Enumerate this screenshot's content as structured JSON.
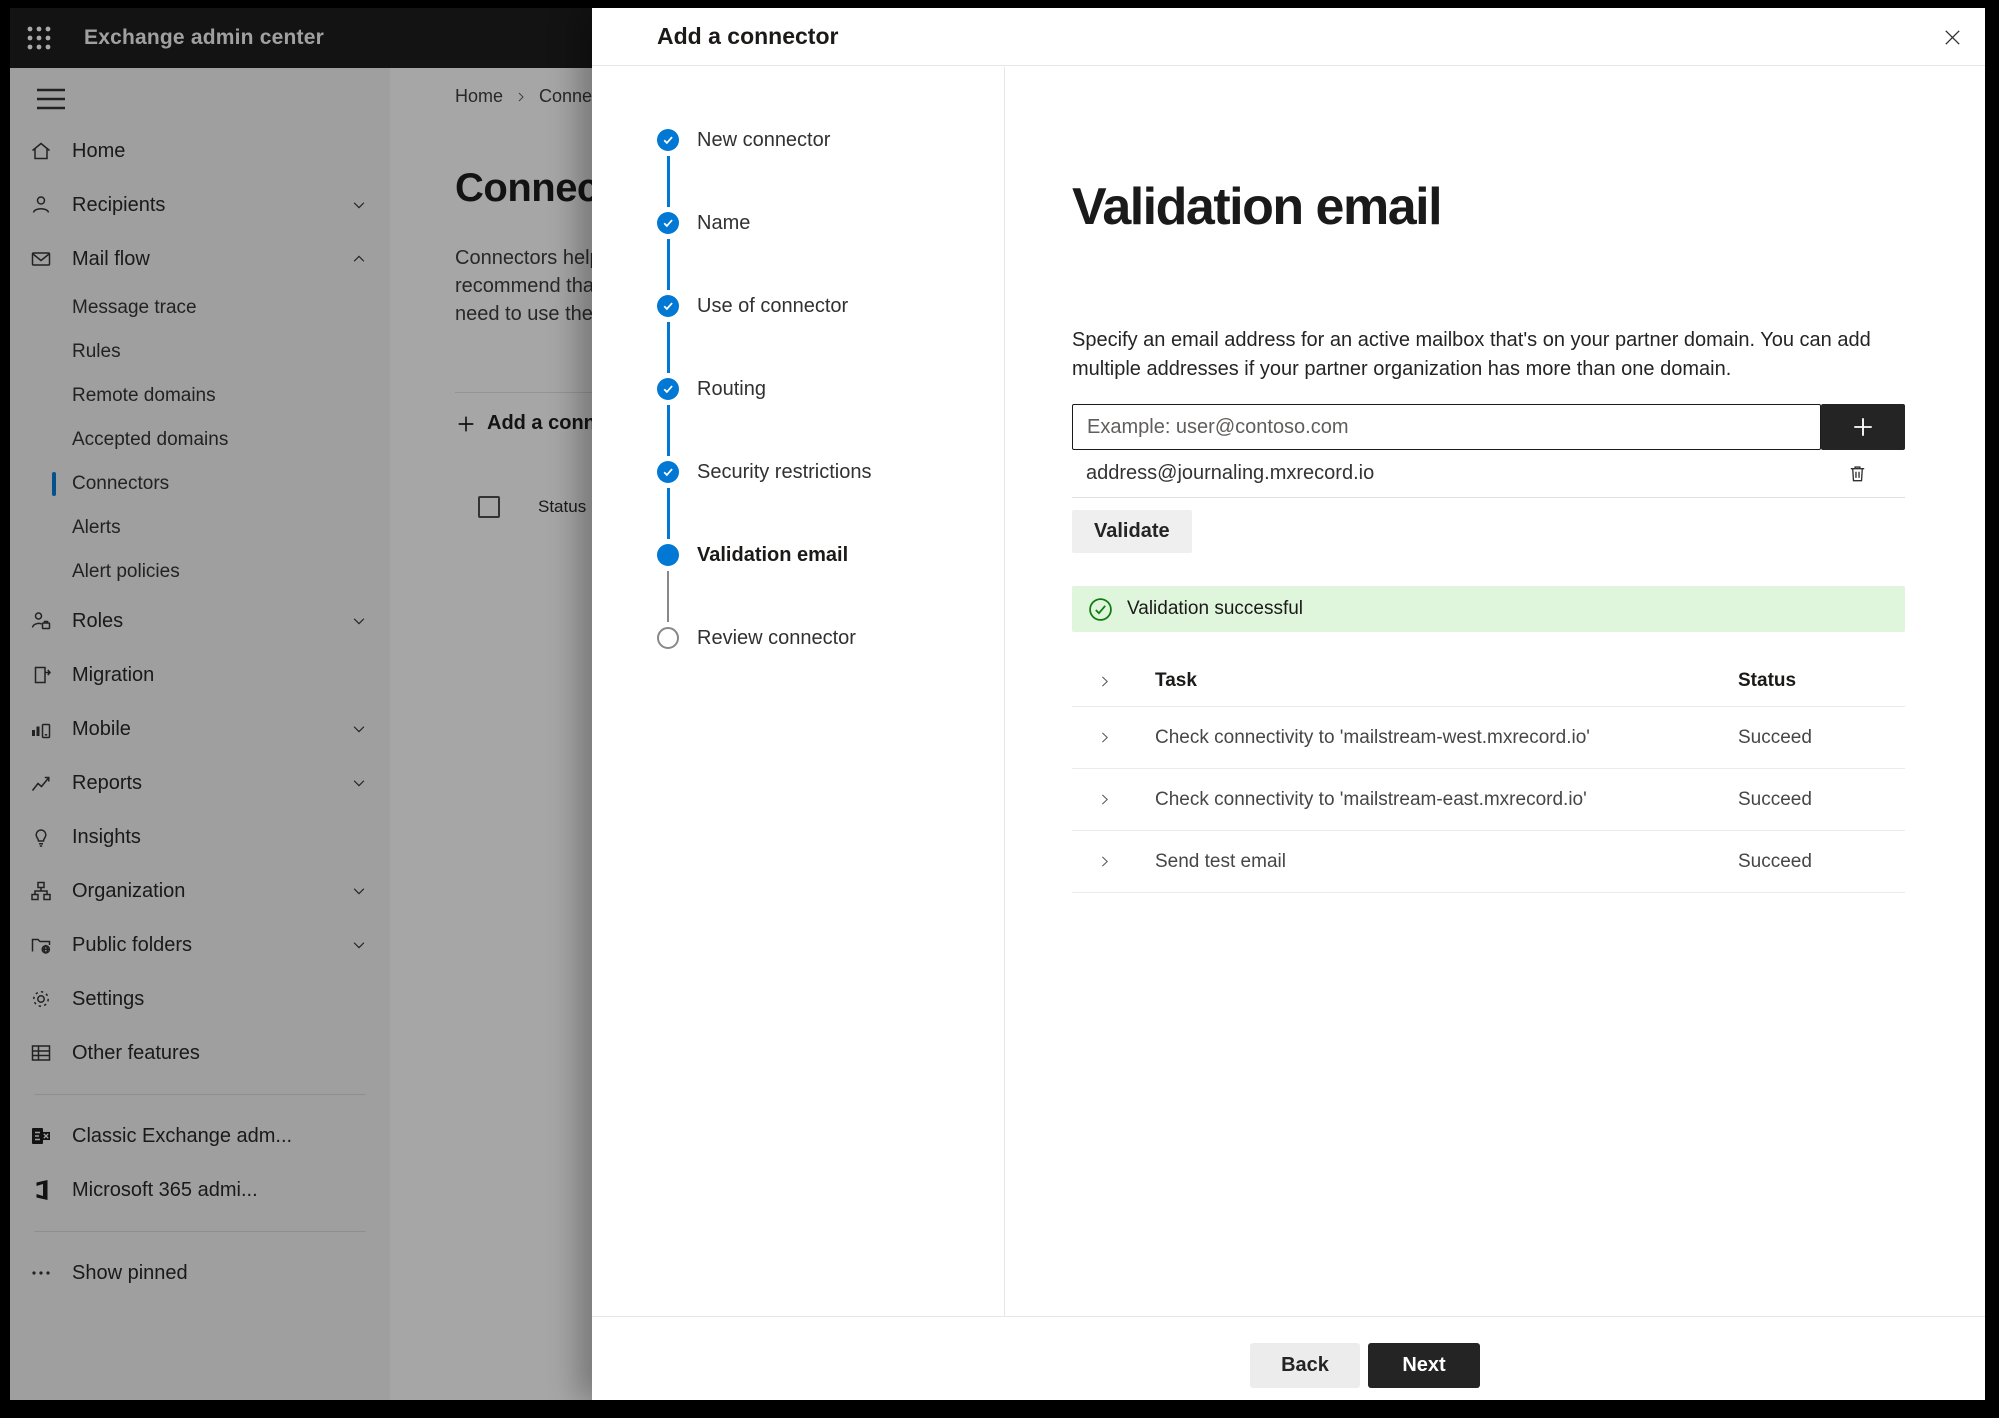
{
  "colors": {
    "accent": "#0078d4",
    "success_bg": "#dff6dd",
    "success_green": "#107c10",
    "dark_button": "#242424"
  },
  "topbar": {
    "title": "Exchange admin center"
  },
  "sidebar": {
    "items": [
      {
        "label": "Home"
      },
      {
        "label": "Recipients"
      },
      {
        "label": "Mail flow"
      },
      {
        "label": "Message trace"
      },
      {
        "label": "Rules"
      },
      {
        "label": "Remote domains"
      },
      {
        "label": "Accepted domains"
      },
      {
        "label": "Connectors",
        "selected": true
      },
      {
        "label": "Alerts"
      },
      {
        "label": "Alert policies"
      },
      {
        "label": "Roles"
      },
      {
        "label": "Migration"
      },
      {
        "label": "Mobile"
      },
      {
        "label": "Reports"
      },
      {
        "label": "Insights"
      },
      {
        "label": "Organization"
      },
      {
        "label": "Public folders"
      },
      {
        "label": "Settings"
      },
      {
        "label": "Other features"
      },
      {
        "label": "Classic Exchange adm..."
      },
      {
        "label": "Microsoft 365 admi..."
      },
      {
        "label": "Show pinned"
      }
    ]
  },
  "page": {
    "breadcrumb": {
      "home": "Home",
      "current": "Connectors"
    },
    "title": "Connectors",
    "desc_lines": [
      "Connectors help",
      "recommend that",
      "need to use them"
    ],
    "add_button": "Add a connector",
    "column_status": "Status"
  },
  "dialog": {
    "title": "Add a connector",
    "steps": [
      {
        "label": "New connector",
        "state": "done"
      },
      {
        "label": "Name",
        "state": "done"
      },
      {
        "label": "Use of connector",
        "state": "done"
      },
      {
        "label": "Routing",
        "state": "done"
      },
      {
        "label": "Security restrictions",
        "state": "done"
      },
      {
        "label": "Validation email",
        "state": "current"
      },
      {
        "label": "Review connector",
        "state": "todo"
      }
    ],
    "content": {
      "heading": "Validation email",
      "desc_lines": [
        "Specify an email address for an active mailbox that's on your partner domain. You can add",
        "multiple addresses if your partner organization has more than one domain."
      ],
      "email_placeholder": "Example: user@contoso.com",
      "added_address": "address@journaling.mxrecord.io",
      "validate_button": "Validate",
      "success_message": "Validation successful",
      "table": {
        "headers": {
          "task": "Task",
          "status": "Status"
        },
        "rows": [
          {
            "task": "Check connectivity to 'mailstream-west.mxrecord.io'",
            "status": "Succeed"
          },
          {
            "task": "Check connectivity to 'mailstream-east.mxrecord.io'",
            "status": "Succeed"
          },
          {
            "task": "Send test email",
            "status": "Succeed"
          }
        ]
      }
    },
    "footer": {
      "back": "Back",
      "next": "Next"
    }
  }
}
